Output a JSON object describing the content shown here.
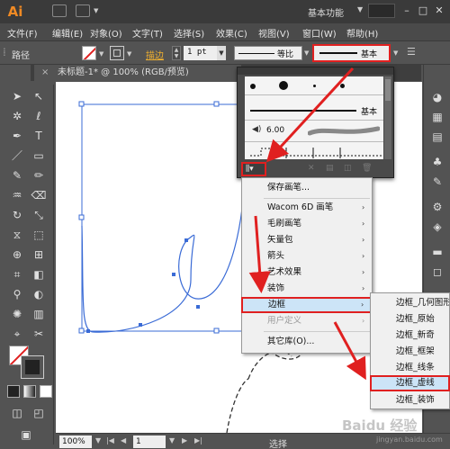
{
  "app": {
    "logo": "Ai",
    "workspace": "基本功能"
  },
  "menubar": [
    "文件(F)",
    "编辑(E)",
    "对象(O)",
    "文字(T)",
    "选择(S)",
    "效果(C)",
    "视图(V)",
    "窗口(W)",
    "帮助(H)"
  ],
  "control": {
    "path_label": "路径",
    "stroke_link": "描边",
    "stroke_weight": "1 pt",
    "profile_label": "等比",
    "brush_label": "基本"
  },
  "document": {
    "tab_title": "未标题-1* @ 100% (RGB/预览)",
    "close_symbol": "×"
  },
  "brush_panel": {
    "basic_label": "基本",
    "size_label": "6.00"
  },
  "library_menu": {
    "items": [
      "保存画笔...",
      "Wacom 6D 画笔",
      "毛刷画笔",
      "矢量包",
      "箭头",
      "艺术效果",
      "装饰",
      "边框",
      "用户定义",
      "其它库(O)..."
    ],
    "highlighted": "边框"
  },
  "border_submenu": {
    "items": [
      "边框_几何图形",
      "边框_原始",
      "边框_新奇",
      "边框_框架",
      "边框_线条",
      "边框_虚线",
      "边框_装饰"
    ],
    "highlighted": "边框_虚线"
  },
  "status": {
    "zoom": "100%",
    "page": "1",
    "text": "选择"
  },
  "watermark": {
    "text": "Baidu 经验",
    "url": "jingyan.baidu.com"
  },
  "colors": {
    "accent_red": "#e02020",
    "highlight": "#cce4f7",
    "path_blue": "#3a6bd6"
  }
}
